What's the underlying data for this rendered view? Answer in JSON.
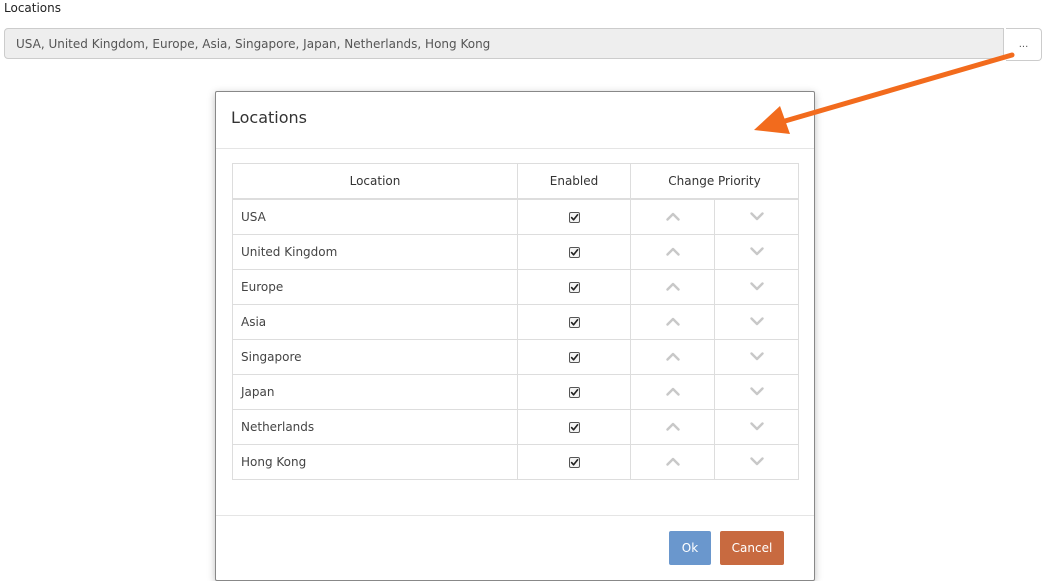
{
  "field": {
    "label": "Locations",
    "value": "USA, United Kingdom, Europe, Asia, Singapore, Japan, Netherlands, Hong Kong",
    "browse_label": "..."
  },
  "modal": {
    "title": "Locations",
    "columns": {
      "location": "Location",
      "enabled": "Enabled",
      "priority": "Change Priority"
    },
    "rows": [
      {
        "name": "USA",
        "enabled": true
      },
      {
        "name": "United Kingdom",
        "enabled": true
      },
      {
        "name": "Europe",
        "enabled": true
      },
      {
        "name": "Asia",
        "enabled": true
      },
      {
        "name": "Singapore",
        "enabled": true
      },
      {
        "name": "Japan",
        "enabled": true
      },
      {
        "name": "Netherlands",
        "enabled": true
      },
      {
        "name": "Hong Kong",
        "enabled": true
      }
    ],
    "ok_label": "Ok",
    "cancel_label": "Cancel"
  },
  "icons": {
    "priority_up": "chevron-up-icon",
    "priority_down": "chevron-down-icon",
    "enabled": "checkbox-checked-icon"
  },
  "colors": {
    "ok_button": "#6a97cd",
    "cancel_button": "#c86a40",
    "annotation_arrow": "#f26b1d"
  }
}
